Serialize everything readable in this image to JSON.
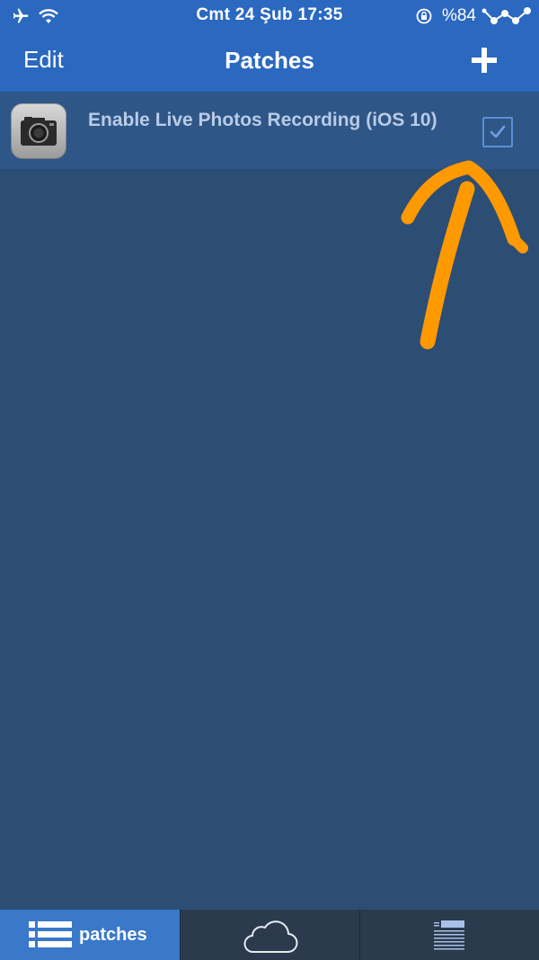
{
  "status_bar": {
    "time": "Cmt 24 Şub 17:35",
    "battery": "%84",
    "icons": [
      "airplane-icon",
      "wifi-icon",
      "rotation-lock-icon",
      "graph-icon"
    ]
  },
  "nav": {
    "edit_label": "Edit",
    "title": "Patches",
    "add_icon": "plus-icon"
  },
  "patches": [
    {
      "title": "Enable Live Photos Recording (iOS 10)",
      "icon": "camera-icon",
      "enabled": true
    }
  ],
  "tabs": [
    {
      "label": "patches",
      "icon": "list-icon",
      "active": true
    },
    {
      "label": "",
      "icon": "cloud-icon",
      "active": false
    },
    {
      "label": "",
      "icon": "log-icon",
      "active": false
    }
  ],
  "colors": {
    "bar": "#2b68bf",
    "background": "#2c4d74",
    "row": "#2e5687",
    "tab_bar": "#2b3a4c",
    "tab_active": "#3a78c9",
    "annotation": "#ff9900"
  }
}
